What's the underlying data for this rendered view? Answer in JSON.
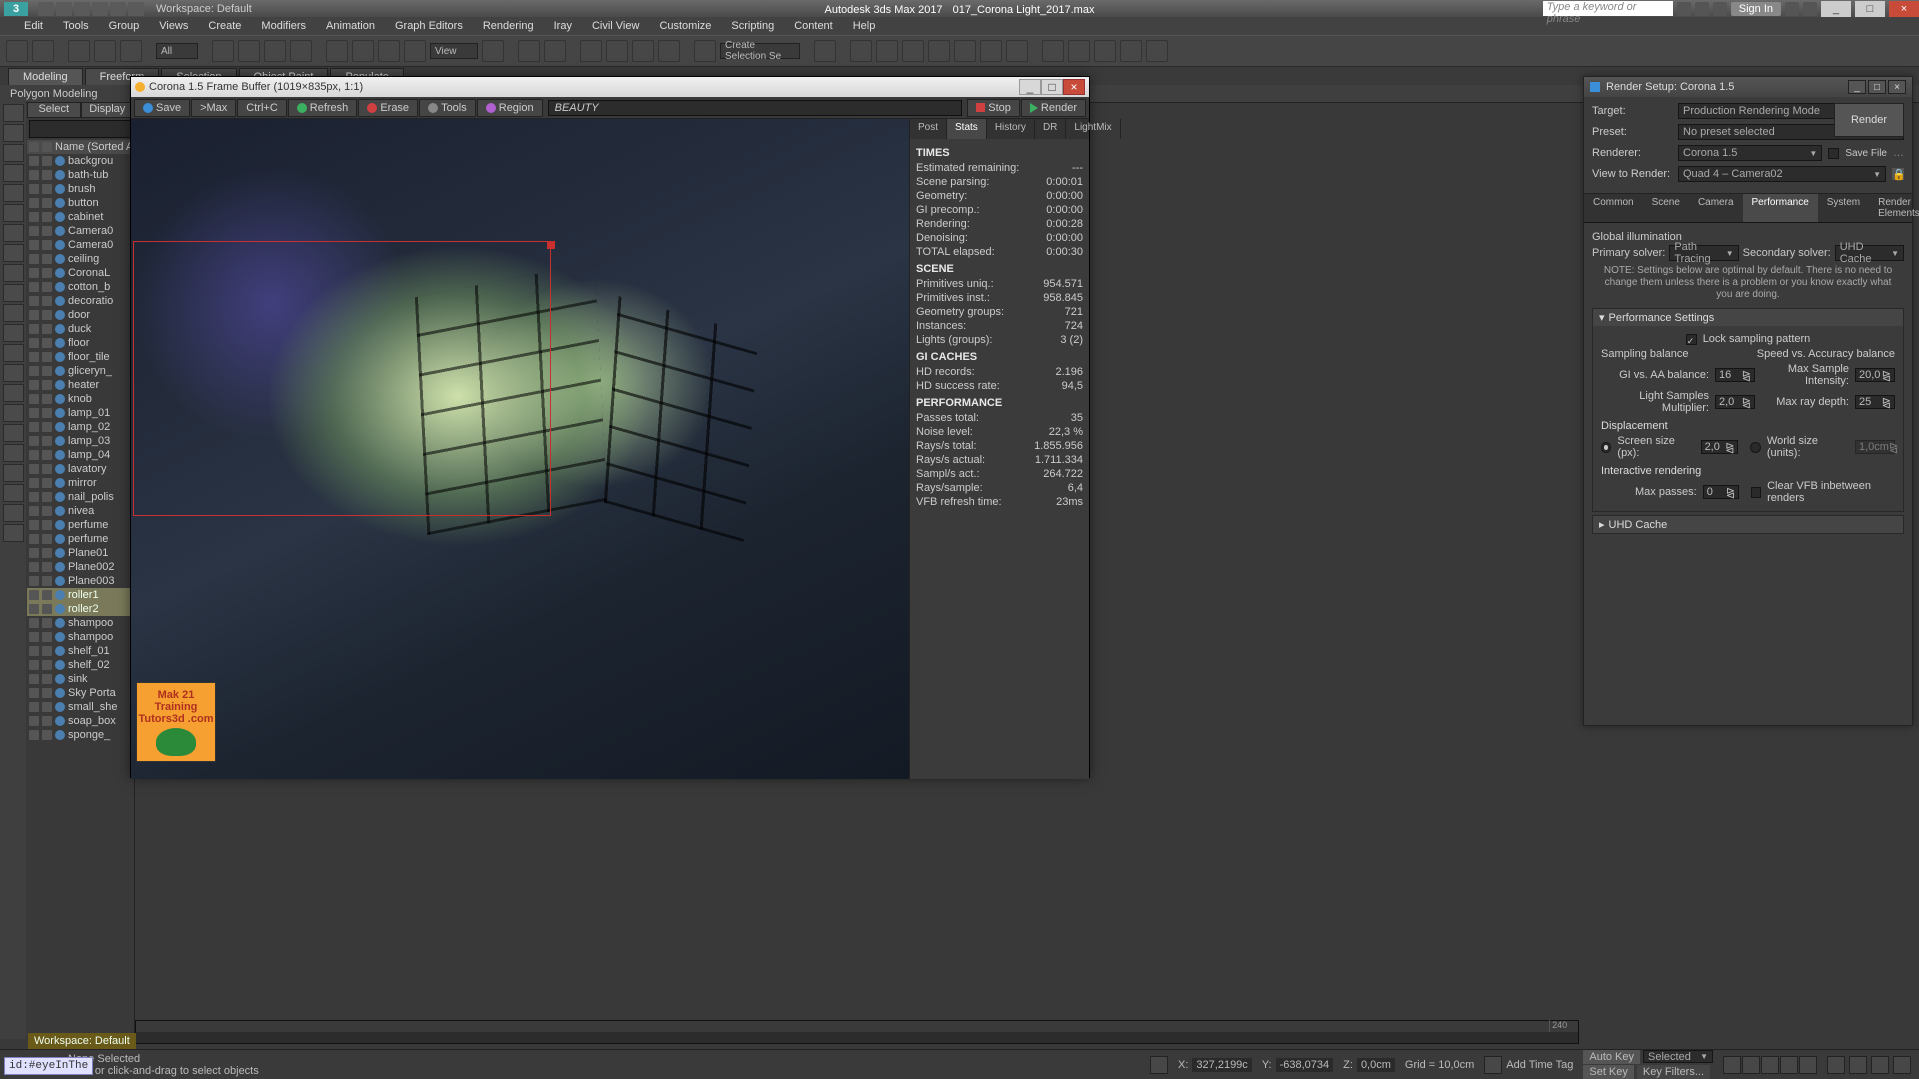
{
  "title": {
    "app": "Autodesk 3ds Max 2017",
    "file": "017_Corona Light_2017.max",
    "workspace_label": "Workspace: Default",
    "signin": "Sign In",
    "search_ph": "Type a keyword or phrase"
  },
  "menus": [
    "Edit",
    "Tools",
    "Group",
    "Views",
    "Create",
    "Modifiers",
    "Animation",
    "Graph Editors",
    "Rendering",
    "Iray",
    "Civil View",
    "Customize",
    "Scripting",
    "Content",
    "Help"
  ],
  "ribbon": {
    "tabs": [
      "Modeling",
      "Freeform",
      "Selection",
      "Object Paint",
      "Populate"
    ],
    "sub": "Polygon Modeling"
  },
  "toolbar": {
    "all": "All",
    "view": "View",
    "create_sel": "Create Selection Se"
  },
  "scene": {
    "tabs": [
      "Select",
      "Display"
    ],
    "header": "Name (Sorted Asce",
    "items": [
      "backgrou",
      "bath-tub",
      "brush",
      "button",
      "cabinet",
      "Camera0",
      "Camera0",
      "ceiling",
      "CoronaL",
      "cotton_b",
      "decoratio",
      "door",
      "duck",
      "floor",
      "floor_tile",
      "gliceryn_",
      "heater",
      "knob",
      "lamp_01",
      "lamp_02",
      "lamp_03",
      "lamp_04",
      "lavatory",
      "mirror",
      "nail_polis",
      "nivea",
      "perfume",
      "perfume",
      "Plane01",
      "Plane002",
      "Plane003",
      "roller1",
      "roller2",
      "shampoo",
      "shampoo",
      "shelf_01",
      "shelf_02",
      "sink",
      "Sky Porta",
      "small_she",
      "soap_box",
      "sponge_"
    ],
    "sel_idx": [
      31,
      32
    ]
  },
  "fb": {
    "title": "Corona 1.5 Frame Buffer (1019×835px, 1:1)",
    "btns": {
      "save": "Save",
      "max": ">Max",
      "ctrlc": "Ctrl+C",
      "refresh": "Refresh",
      "erase": "Erase",
      "tools": "Tools",
      "region": "Region",
      "stop": "Stop",
      "render": "Render"
    },
    "channel": "BEAUTY",
    "stats_tabs": [
      "Post",
      "Stats",
      "History",
      "DR",
      "LightMix"
    ],
    "stats_active": 1,
    "stats": {
      "TIMES": [
        [
          "Estimated remaining:",
          "---"
        ],
        [
          "Scene parsing:",
          "0:00:01"
        ],
        [
          "Geometry:",
          "0:00:00"
        ],
        [
          "GI precomp.:",
          "0:00:00"
        ],
        [
          "Rendering:",
          "0:00:28"
        ],
        [
          "Denoising:",
          "0:00:00"
        ],
        [
          "TOTAL elapsed:",
          "0:00:30"
        ]
      ],
      "SCENE": [
        [
          "Primitives uniq.:",
          "954.571"
        ],
        [
          "Primitives inst.:",
          "958.845"
        ],
        [
          "Geometry groups:",
          "721"
        ],
        [
          "Instances:",
          "724"
        ],
        [
          "Lights (groups):",
          "3 (2)"
        ]
      ],
      "GI CACHES": [
        [
          "HD records:",
          "2.196"
        ],
        [
          "HD success rate:",
          "94,5"
        ]
      ],
      "PERFORMANCE": [
        [
          "Passes total:",
          "35"
        ],
        [
          "Noise level:",
          "22,3 %"
        ],
        [
          "Rays/s total:",
          "1.855.956"
        ],
        [
          "Rays/s actual:",
          "1.711.334"
        ],
        [
          "Sampl/s act.:",
          "264.722"
        ],
        [
          "Rays/sample:",
          "6,4"
        ],
        [
          "VFB refresh time:",
          "23ms"
        ]
      ]
    }
  },
  "rp": {
    "title": "Render Setup: Corona 1.5",
    "target_l": "Target:",
    "target": "Production Rendering Mode",
    "preset_l": "Preset:",
    "preset": "No preset selected",
    "renderer_l": "Renderer:",
    "renderer": "Corona 1.5",
    "savefile": "Save File",
    "view_l": "View to Render:",
    "view": "Quad 4 – Camera02",
    "render_btn": "Render",
    "tabs": [
      "Common",
      "Scene",
      "Camera",
      "Performance",
      "System",
      "Render Elements"
    ],
    "active_tab": 3,
    "gi": {
      "h": "Global illumination",
      "primary_l": "Primary solver:",
      "primary": "Path Tracing",
      "secondary_l": "Secondary solver:",
      "secondary": "UHD Cache"
    },
    "note": "NOTE: Settings below are optimal by default. There is no need to change them unless there is a problem or you know exactly what you are doing.",
    "perf": {
      "h": "Performance Settings",
      "lock": "Lock sampling pattern",
      "sb": "Sampling balance",
      "sa": "Speed vs. Accuracy balance",
      "gi_aa_l": "GI vs. AA balance:",
      "gi_aa": "16",
      "msi_l": "Max Sample Intensity:",
      "msi": "20,0",
      "lsm_l": "Light Samples Multiplier:",
      "lsm": "2,0",
      "mrd_l": "Max ray depth:",
      "mrd": "25",
      "disp_h": "Displacement",
      "ss_l": "Screen size (px):",
      "ss": "2,0",
      "ws_l": "World size (units):",
      "ws": "1,0cm",
      "ir_h": "Interactive rendering",
      "mp_l": "Max passes:",
      "mp": "0",
      "clear": "Clear VFB inbetween renders",
      "uhd": "UHD Cache"
    }
  },
  "status": {
    "none": "None Selected",
    "hint": "Click or click-and-drag to select objects",
    "x": "X:",
    "xv": "327,2199c",
    "y": "Y:",
    "yv": "-638,0734",
    "z": "Z:",
    "zv": "0,0cm",
    "grid": "Grid = 10,0cm",
    "addtime": "Add Time Tag",
    "autokey": "Auto Key",
    "setkey": "Set Key",
    "selected": "Selected",
    "keyfilters": "Key Filters...",
    "ws": "Workspace: Default",
    "face": "id:#eyeInThe"
  },
  "training": {
    "l1": "Mak 21 Training",
    "l2": "Tutors3d .com"
  },
  "timeline": {
    "tick": "240"
  }
}
